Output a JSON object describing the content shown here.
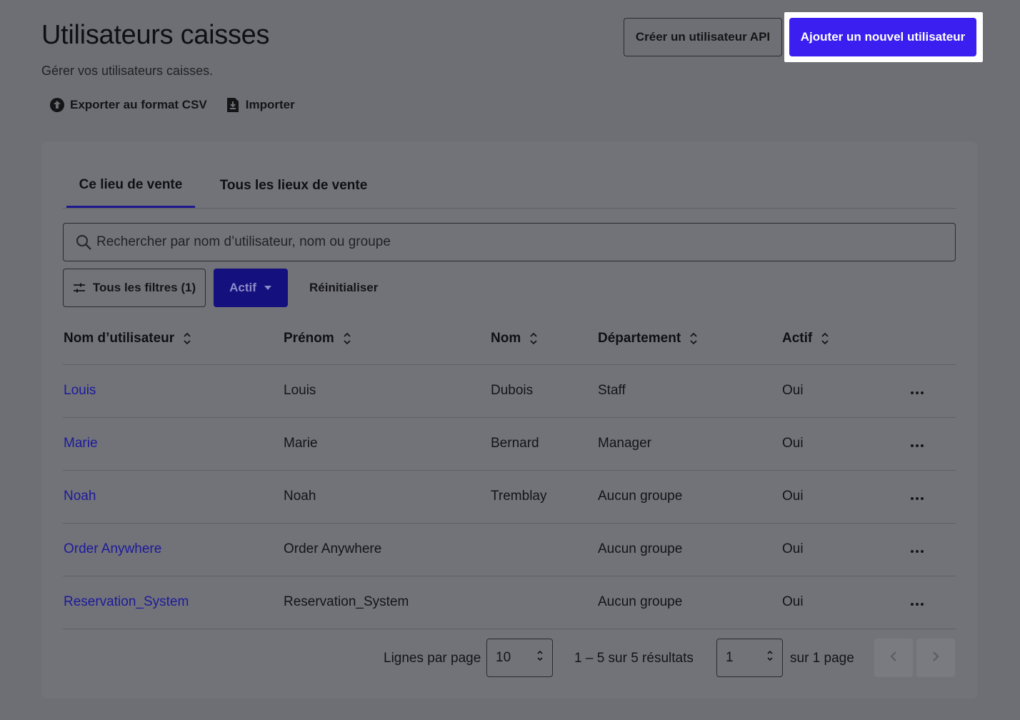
{
  "header": {
    "title": "Utilisateurs caisses",
    "subtitle": "Gérer vos utilisateurs caisses.",
    "export_label": "Exporter au format CSV",
    "import_label": "Importer",
    "create_api_label": "Créer un utilisateur API",
    "add_user_label": "Ajouter un nouvel utilisateur"
  },
  "tabs": [
    {
      "label": "Ce lieu de vente",
      "active": true
    },
    {
      "label": "Tous les lieux de vente",
      "active": false
    }
  ],
  "search": {
    "placeholder": "Rechercher par nom d’utilisateur, nom ou groupe",
    "value": ""
  },
  "filters": {
    "all_filters_label": "Tous les filtres (1)",
    "active_chip_label": "Actif",
    "reset_label": "Réinitialiser"
  },
  "table": {
    "columns": [
      "Nom d’utilisateur",
      "Prénom",
      "Nom",
      "Département",
      "Actif"
    ],
    "rows": [
      {
        "username": "Louis",
        "firstname": "Louis",
        "lastname": "Dubois",
        "department": "Staff",
        "active": "Oui"
      },
      {
        "username": "Marie",
        "firstname": "Marie",
        "lastname": "Bernard",
        "department": "Manager",
        "active": "Oui"
      },
      {
        "username": "Noah",
        "firstname": "Noah",
        "lastname": "Tremblay",
        "department": "Aucun groupe",
        "active": "Oui"
      },
      {
        "username": "Order Anywhere",
        "firstname": "Order Anywhere",
        "lastname": "",
        "department": "Aucun groupe",
        "active": "Oui"
      },
      {
        "username": "Reservation_System",
        "firstname": "Reservation_System",
        "lastname": "",
        "department": "Aucun groupe",
        "active": "Oui"
      }
    ]
  },
  "pagination": {
    "rows_per_page_label": "Lignes par page",
    "rows_per_page_value": "10",
    "results_text": "1 – 5 sur 5 résultats",
    "page_value": "1",
    "page_total_text": "sur 1 page"
  },
  "colors": {
    "primary": "#3a1ff0",
    "link": "#1d1a9c",
    "active_chip": "#14107e",
    "overlay_bg": "#6e6f74"
  }
}
